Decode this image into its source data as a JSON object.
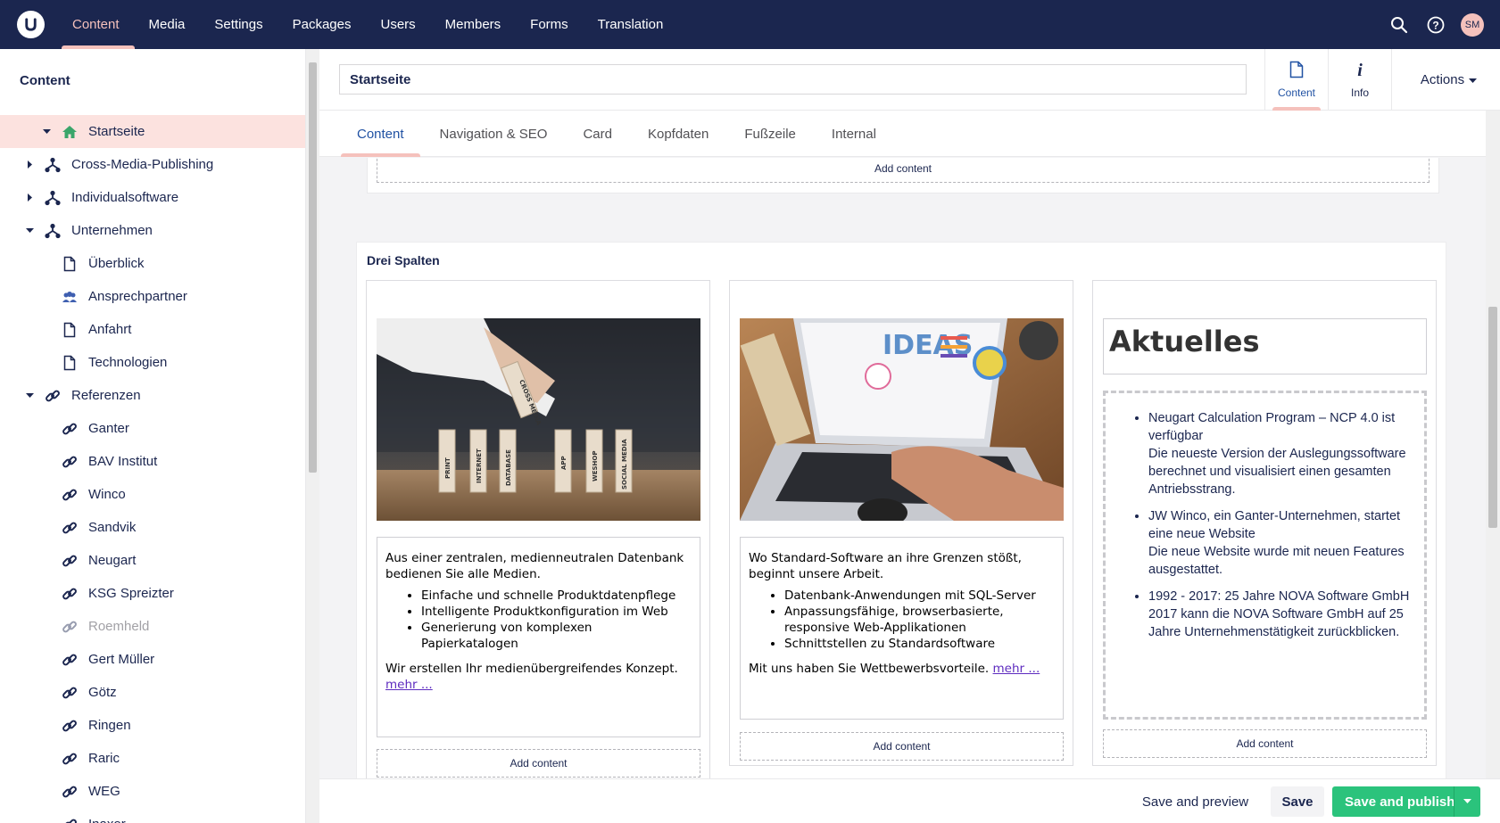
{
  "topnav": {
    "items": [
      "Content",
      "Media",
      "Settings",
      "Packages",
      "Users",
      "Members",
      "Forms",
      "Translation"
    ],
    "active_index": 0,
    "avatar_initials": "SM"
  },
  "sidebar": {
    "title": "Content",
    "tree": [
      {
        "label": "Startseite",
        "icon": "home-icon",
        "active": true
      },
      {
        "label": "Cross-Media-Publishing",
        "icon": "sitemap-icon"
      },
      {
        "label": "Individualsoftware",
        "icon": "sitemap-icon"
      },
      {
        "label": "Unternehmen",
        "icon": "sitemap-icon"
      },
      {
        "label": "Überblick",
        "icon": "document-icon"
      },
      {
        "label": "Ansprechpartner",
        "icon": "users-icon"
      },
      {
        "label": "Anfahrt",
        "icon": "document-icon"
      },
      {
        "label": "Technologien",
        "icon": "document-icon"
      },
      {
        "label": "Referenzen",
        "icon": "link-icon"
      },
      {
        "label": "Ganter",
        "icon": "link-icon"
      },
      {
        "label": "BAV Institut",
        "icon": "link-icon"
      },
      {
        "label": "Winco",
        "icon": "link-icon"
      },
      {
        "label": "Sandvik",
        "icon": "link-icon"
      },
      {
        "label": "Neugart",
        "icon": "link-icon"
      },
      {
        "label": "KSG Spreizter",
        "icon": "link-icon"
      },
      {
        "label": "Roemheld",
        "icon": "link-icon",
        "unpublished": true
      },
      {
        "label": "Gert Müller",
        "icon": "link-icon"
      },
      {
        "label": "Götz",
        "icon": "link-icon"
      },
      {
        "label": "Ringen",
        "icon": "link-icon"
      },
      {
        "label": "Raric",
        "icon": "link-icon"
      },
      {
        "label": "WEG",
        "icon": "link-icon"
      },
      {
        "label": "Inaxor",
        "icon": "link-icon"
      }
    ]
  },
  "editor": {
    "node_name": "Startseite",
    "apps": [
      {
        "label": "Content",
        "icon": "document-icon"
      },
      {
        "label": "Info",
        "icon": "info-icon"
      }
    ],
    "actions_label": "Actions",
    "tabs": [
      "Content",
      "Navigation & SEO",
      "Card",
      "Kopfdaten",
      "Fußzeile",
      "Internal"
    ],
    "add_content_label": "Add content",
    "section_title": "Drei Spalten",
    "col1": {
      "intro": "Aus einer zentralen, medienneutralen Datenbank bedienen Sie alle Medien.",
      "bullets": [
        "Einfache und schnelle Produktdatenpflege",
        "Intelligente Produktkonfiguration im Web",
        "Generierung von komplexen Papierkatalogen"
      ],
      "outro": "Wir erstellen Ihr medienübergreifendes Konzept.",
      "link": "mehr ...",
      "image_blocks": [
        "PRINT",
        "INTERNET",
        "DATABASE",
        "APP",
        "WESHOP",
        "SOCIAL MEDIA",
        "CROSS MEDIA"
      ]
    },
    "col2": {
      "intro": "Wo Standard-Software an ihre Grenzen stößt, beginnt unsere Arbeit.",
      "bullets": [
        "Datenbank-Anwendungen mit SQL-Server",
        "Anpassungsfähige, browserbasierte, responsive Web-Applikationen",
        "Schnittstellen zu Standardsoftware"
      ],
      "outro": "Mit uns haben Sie Wettbewerbsvorteile.",
      "link": "mehr ...",
      "image_text": "IDEAS"
    },
    "col3": {
      "heading": "Aktuelles",
      "news": [
        {
          "title": "Neugart Calculation Program – NCP 4.0 ist verfügbar",
          "text": "Die neueste Version der Auslegungssoftware berechnet und visualisiert einen gesamten Antriebsstrang."
        },
        {
          "title": "JW Winco, ein Ganter-Unternehmen, startet eine neue Website",
          "text": "Die neue Website wurde mit neuen Features ausgestattet."
        },
        {
          "title": "1992 - 2017: 25 Jahre NOVA Software GmbH",
          "text": "2017 kann die NOVA Software GmbH auf 25 Jahre Unternehmenstätigkeit zurückblicken."
        }
      ]
    }
  },
  "footer": {
    "preview_label": "Save and preview",
    "save_label": "Save",
    "publish_label": "Save and publish"
  },
  "colors": {
    "navy": "#1b264f",
    "accent_pink": "#f5c1bc",
    "selected_row": "#fce2df",
    "publish_green": "#2bc37c",
    "link_blue": "#2152a3"
  }
}
